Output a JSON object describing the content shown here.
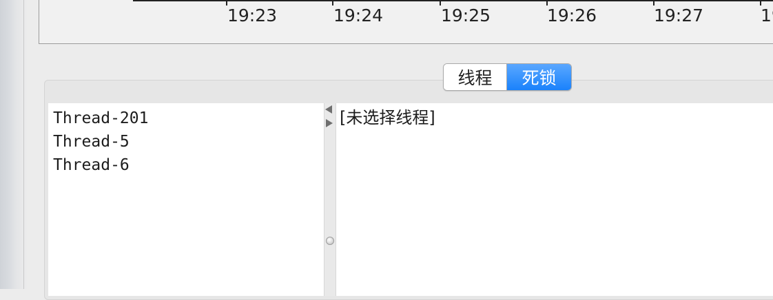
{
  "chart": {
    "time_ticks": [
      "19:23",
      "19:24",
      "19:25",
      "19:26",
      "19:27",
      "19"
    ]
  },
  "tabs": [
    {
      "label": "线程",
      "selected": false
    },
    {
      "label": "死锁",
      "selected": true
    }
  ],
  "threads": [
    "Thread-201",
    "Thread-5",
    "Thread-6"
  ],
  "detail": {
    "placeholder_text": "[未选择线程]"
  },
  "colors": {
    "tab_selected": "#1a82fb",
    "background": "#ececec"
  }
}
